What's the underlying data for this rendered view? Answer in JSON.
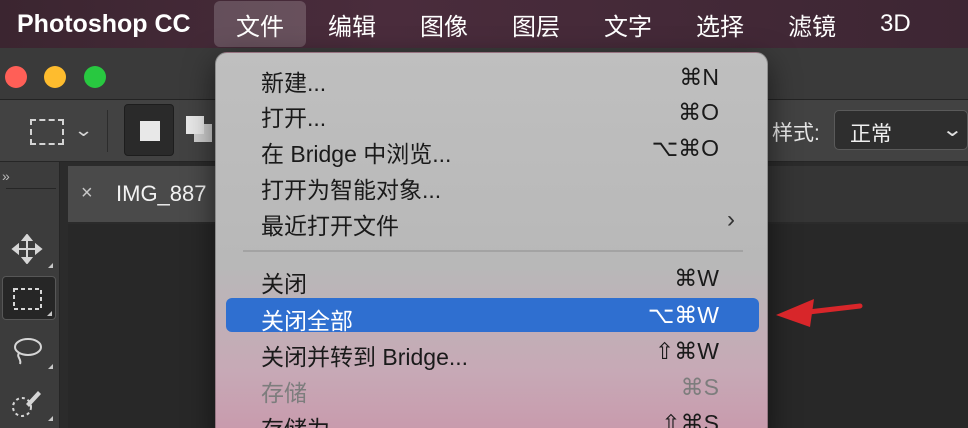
{
  "menubar": {
    "app_name": "Photoshop CC",
    "items": [
      "文件",
      "编辑",
      "图像",
      "图层",
      "文字",
      "选择",
      "滤镜",
      "3D"
    ],
    "active_index": 0
  },
  "options_bar": {
    "style_label": "样式:",
    "style_value": "正常"
  },
  "document": {
    "tab_title": "IMG_887",
    "close_glyph": "×"
  },
  "tools_panel": {
    "collapse_glyph": "»",
    "tools": [
      "move-tool",
      "rectangular-marquee-tool",
      "lasso-tool",
      "quick-selection-tool"
    ]
  },
  "file_menu": {
    "group1": [
      {
        "label": "新建...",
        "shortcut": "⌘N"
      },
      {
        "label": "打开...",
        "shortcut": "⌘O"
      },
      {
        "label": "在 Bridge 中浏览...",
        "shortcut": "⌥⌘O"
      },
      {
        "label": "打开为智能对象...",
        "shortcut": ""
      },
      {
        "label": "最近打开文件",
        "shortcut": "",
        "submenu_glyph": "›"
      }
    ],
    "group2": [
      {
        "label": "关闭",
        "shortcut": "⌘W"
      },
      {
        "label": "关闭全部",
        "shortcut": "⌥⌘W",
        "highlighted": true
      },
      {
        "label": "关闭并转到 Bridge...",
        "shortcut": "⇧⌘W"
      },
      {
        "label": "存储",
        "shortcut": "⌘S",
        "disabled": true
      },
      {
        "label": "存储为",
        "shortcut": "⇧⌘S"
      }
    ]
  },
  "colors": {
    "highlight": "#2f6fd0",
    "annotation_arrow": "#d8262a",
    "menubar": "#4a2c3c"
  }
}
